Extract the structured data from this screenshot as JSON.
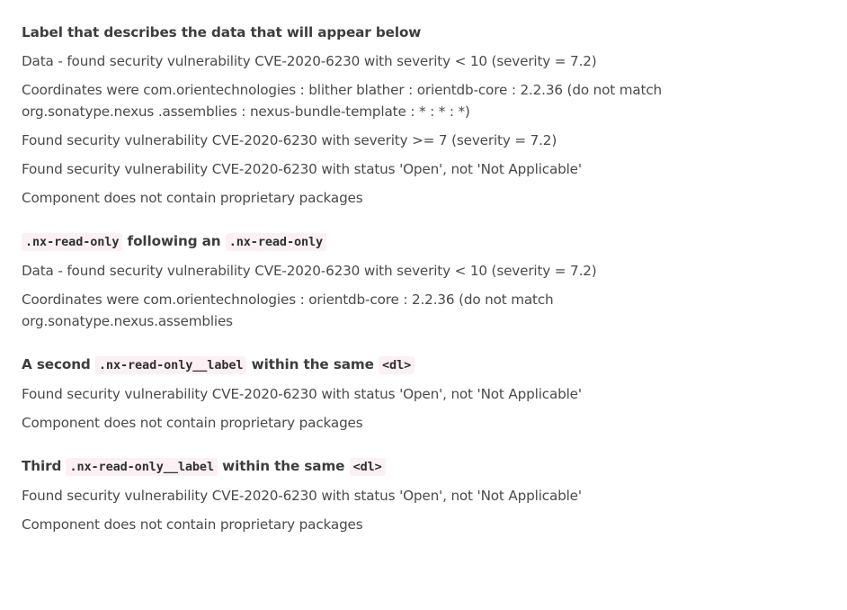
{
  "groups": [
    {
      "label_parts": [
        {
          "type": "text",
          "text": "Label that describes the data that will appear below"
        }
      ],
      "values": [
        "Data - found security vulnerability CVE-2020-6230 with severity < 10 (severity = 7.2)",
        "Coordinates were com.orientechnologies : blither blather : orientdb-core : 2.2.36 (do not match org.sonatype.nexus .assemblies : nexus-bundle-template : * : * : *)",
        "Found security vulnerability CVE-2020-6230 with severity >= 7 (severity = 7.2)",
        "Found security vulnerability CVE-2020-6230 with status 'Open', not 'Not Applicable'",
        "Component does not contain proprietary packages"
      ]
    },
    {
      "label_parts": [
        {
          "type": "code",
          "text": ".nx-read-only"
        },
        {
          "type": "text",
          "text": " following an "
        },
        {
          "type": "code",
          "text": ".nx-read-only"
        }
      ],
      "values": [
        "Data - found security vulnerability CVE-2020-6230 with severity < 10 (severity = 7.2)",
        "Coordinates were com.orientechnologies : orientdb-core : 2.2.36 (do not match org.sonatype.nexus.assemblies"
      ]
    },
    {
      "label_parts": [
        {
          "type": "text",
          "text": "A second "
        },
        {
          "type": "code",
          "text": ".nx-read-only__label"
        },
        {
          "type": "text",
          "text": " within the same "
        },
        {
          "type": "code",
          "text": "<dl>"
        }
      ],
      "values": [
        "Found security vulnerability CVE-2020-6230 with status 'Open', not 'Not Applicable'",
        "Component does not contain proprietary packages"
      ]
    },
    {
      "label_parts": [
        {
          "type": "text",
          "text": "Third "
        },
        {
          "type": "code",
          "text": ".nx-read-only__label"
        },
        {
          "type": "text",
          "text": " within the same "
        },
        {
          "type": "code",
          "text": "<dl>"
        }
      ],
      "values": [
        "Found security vulnerability CVE-2020-6230 with status 'Open', not 'Not Applicable'",
        "Component does not contain proprietary packages"
      ]
    }
  ]
}
